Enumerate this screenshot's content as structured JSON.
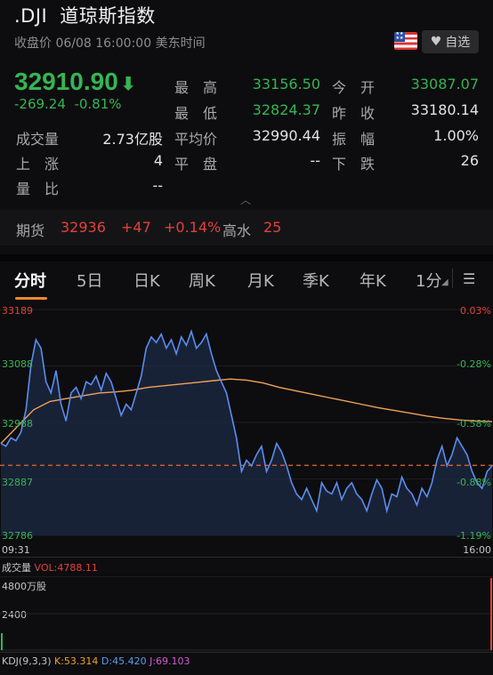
{
  "header": {
    "symbol": ".DJI",
    "name": "道琼斯指数",
    "status": "收盘价 06/08 16:00:00 美东时间",
    "fav_label": "自选"
  },
  "quote": {
    "price": "32910.90",
    "change": "-269.24",
    "change_pct": "-0.81%",
    "stats": [
      {
        "label": "最　高",
        "value": "33156.50"
      },
      {
        "label": "今　开",
        "value": "33087.07"
      },
      {
        "label": "最　低",
        "value": "32824.37"
      },
      {
        "label": "昨　收",
        "value": "33180.14"
      },
      {
        "label": "成交量",
        "value": "2.73亿股"
      },
      {
        "label": "平均价",
        "value": "32990.44"
      },
      {
        "label": "振　幅",
        "value": "1.00%"
      },
      {
        "label": "上　涨",
        "value": "4"
      },
      {
        "label": "平　盘",
        "value": "--"
      },
      {
        "label": "下　跌",
        "value": "26"
      },
      {
        "label": "量　比",
        "value": "--"
      }
    ]
  },
  "futures": {
    "label": "期货",
    "price": "32936",
    "change": "+47",
    "change_pct": "+0.14%",
    "watermark_label": "高水",
    "watermark_value": "25"
  },
  "tabs": [
    "分时",
    "5日",
    "日K",
    "周K",
    "月K",
    "季K",
    "年K",
    "1分"
  ],
  "chart": {
    "left_ticks": [
      "33189",
      "33088",
      "32988",
      "32887",
      "32786"
    ],
    "right_ticks": [
      "0.03%",
      "-0.28%",
      "-0.58%",
      "-0.88%",
      "-1.19%"
    ],
    "time_start": "09:31",
    "time_end": "16:00"
  },
  "volume": {
    "label": "成交量",
    "vol_text": "VOL:4788.11",
    "tick_top": "4800万股",
    "tick_mid": "2400"
  },
  "kdj": {
    "label": "KDJ(9,3,3)",
    "k": "K:53.314",
    "d": "D:45.420",
    "j": "J:69.103"
  },
  "chart_data": {
    "type": "line",
    "title": "",
    "x_range": [
      "09:31",
      "16:00"
    ],
    "ylim": [
      32786,
      33189
    ],
    "reference_prev_close": 33180.14,
    "series": [
      {
        "values": [
          32950,
          32945,
          32960,
          32955,
          32970,
          33010,
          33090,
          33135,
          33120,
          33060,
          33040,
          33080,
          33020,
          32990,
          33040,
          33050,
          33030,
          33060,
          33055,
          33070,
          33045,
          33075,
          33060,
          33030,
          33000,
          33020,
          33010,
          33040,
          33070,
          33120,
          33140,
          33130,
          33145,
          33120,
          33135,
          33110,
          33140,
          33125,
          33150,
          33120,
          33130,
          33145,
          33110,
          33080,
          33060,
          33040,
          33000,
          32960,
          32900,
          32920,
          32910,
          32930,
          32945,
          32900,
          32920,
          32950,
          32935,
          32910,
          32880,
          32860,
          32850,
          32870,
          32850,
          32830,
          32880,
          32865,
          32860,
          32880,
          32850,
          32870,
          32880,
          32860,
          32850,
          32830,
          32860,
          32885,
          32870,
          32830,
          32860,
          32855,
          32890,
          32870,
          32860,
          32840,
          32870,
          32855,
          32880,
          32920,
          32945,
          32910,
          32930,
          32960,
          32945,
          32930,
          32900,
          32880,
          32870,
          32900,
          32910
        ]
      }
    ],
    "avg_line": [
      32950,
      32980,
      33010,
      33025,
      33030,
      33035,
      33040,
      33042,
      33045,
      33050,
      33053,
      33056,
      33059,
      33062,
      33065,
      33063,
      33058,
      33050,
      33044,
      33038,
      33032,
      33026,
      33020,
      33014,
      33009,
      33004,
      32999,
      32995,
      32992,
      32990,
      32989
    ]
  }
}
